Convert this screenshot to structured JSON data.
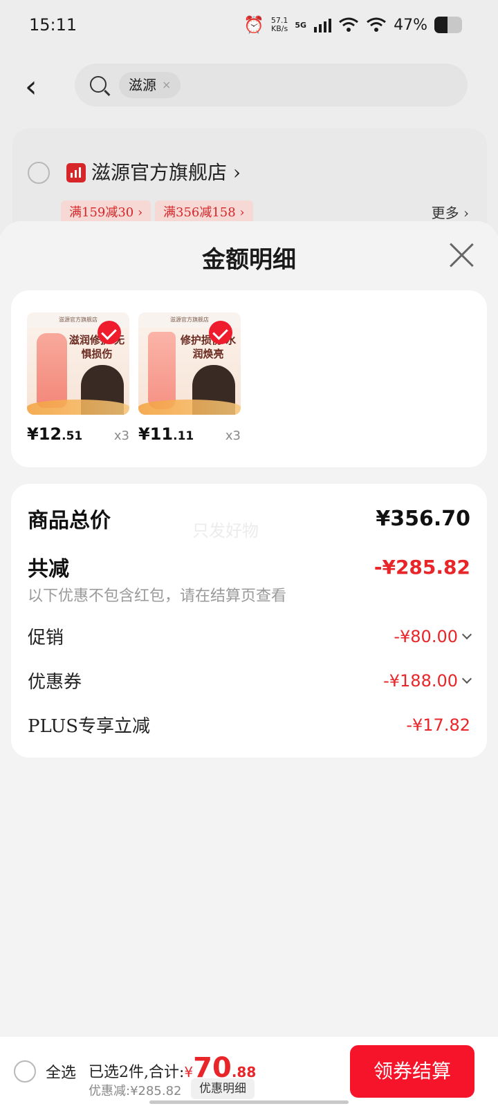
{
  "status_bar": {
    "time": "15:11",
    "net_speed_value": "57.1",
    "net_speed_unit": "KB/s",
    "signal_label": "5G",
    "battery_percent": "47%",
    "battery_level": 0.47
  },
  "search": {
    "back_icon": "chevron-left-icon",
    "keyword": "滋源",
    "clear_symbol": "×"
  },
  "store": {
    "name": "滋源官方旗舰店",
    "chevron": "›",
    "promos": [
      "满159减30 ›",
      "满356减158 ›"
    ],
    "more_label": "更多 ›"
  },
  "sheet": {
    "title": "金额明细",
    "goods": [
      {
        "image_header": "滋源官方旗舰店",
        "image_slogan": "滋润修护 无惧损伤",
        "price_int": "¥12",
        "price_dec": ".51",
        "qty": "x3",
        "checked": true
      },
      {
        "image_header": "滋源官方旗舰店",
        "image_slogan": "修护损伤 水润焕亮",
        "price_int": "¥11",
        "price_dec": ".11",
        "qty": "x3",
        "checked": true
      }
    ],
    "watermark": "只发好物",
    "total_label": "商品总价",
    "total_value": "¥356.70",
    "discount_label": "共减",
    "discount_value": "-¥285.82",
    "discount_note": "以下优惠不包含红包，请在结算页查看",
    "lines": [
      {
        "label": "促销",
        "value": "-¥80.00",
        "expandable": true
      },
      {
        "label": "优惠券",
        "value": "-¥188.00",
        "expandable": true
      },
      {
        "label": "PLUS专享立减",
        "value": "-¥17.82",
        "expandable": false
      }
    ]
  },
  "bottom_bar": {
    "select_all_label": "全选",
    "selected_text": "已选2件,合计:",
    "price_symbol": "¥",
    "price_int": "70",
    "price_dec": ".88",
    "discount_text": "优惠减:¥285.82",
    "discount_detail_button": "优惠明细",
    "checkout_button": "领券结算"
  },
  "colors": {
    "accent_red": "#e8262a",
    "checkout_bg": "#f5142a",
    "store_logo": "#d7262a"
  }
}
